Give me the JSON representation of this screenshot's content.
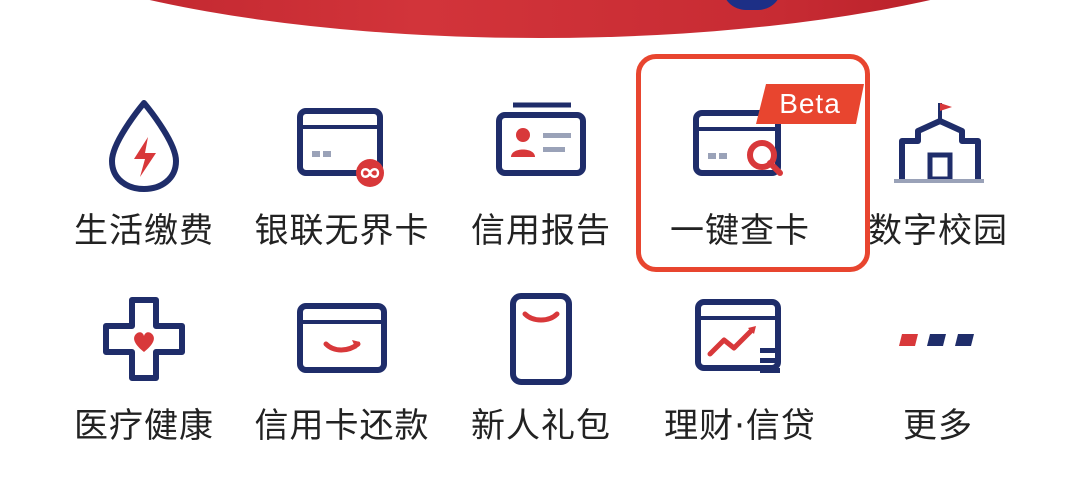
{
  "colors": {
    "navy": "#1f2d6a",
    "red": "#d8383a",
    "highlight_border": "#e8452f",
    "text": "#222222"
  },
  "badge": {
    "label": "Beta"
  },
  "grid": {
    "row1": [
      {
        "label": "生活缴费",
        "icon": "water-drop-lightning-icon"
      },
      {
        "label": "银联无界卡",
        "icon": "card-infinity-icon"
      },
      {
        "label": "信用报告",
        "icon": "id-card-icon"
      },
      {
        "label": "一键查卡",
        "icon": "card-search-icon",
        "highlighted": true
      },
      {
        "label": "数字校园",
        "icon": "school-building-icon"
      }
    ],
    "row2": [
      {
        "label": "医疗健康",
        "icon": "medical-cross-heart-icon"
      },
      {
        "label": "信用卡还款",
        "icon": "card-repay-icon"
      },
      {
        "label": "新人礼包",
        "icon": "gift-pack-icon"
      },
      {
        "label": "理财·信贷",
        "icon": "finance-chart-icon"
      },
      {
        "label": "更多",
        "icon": "more-dots-icon"
      }
    ]
  }
}
